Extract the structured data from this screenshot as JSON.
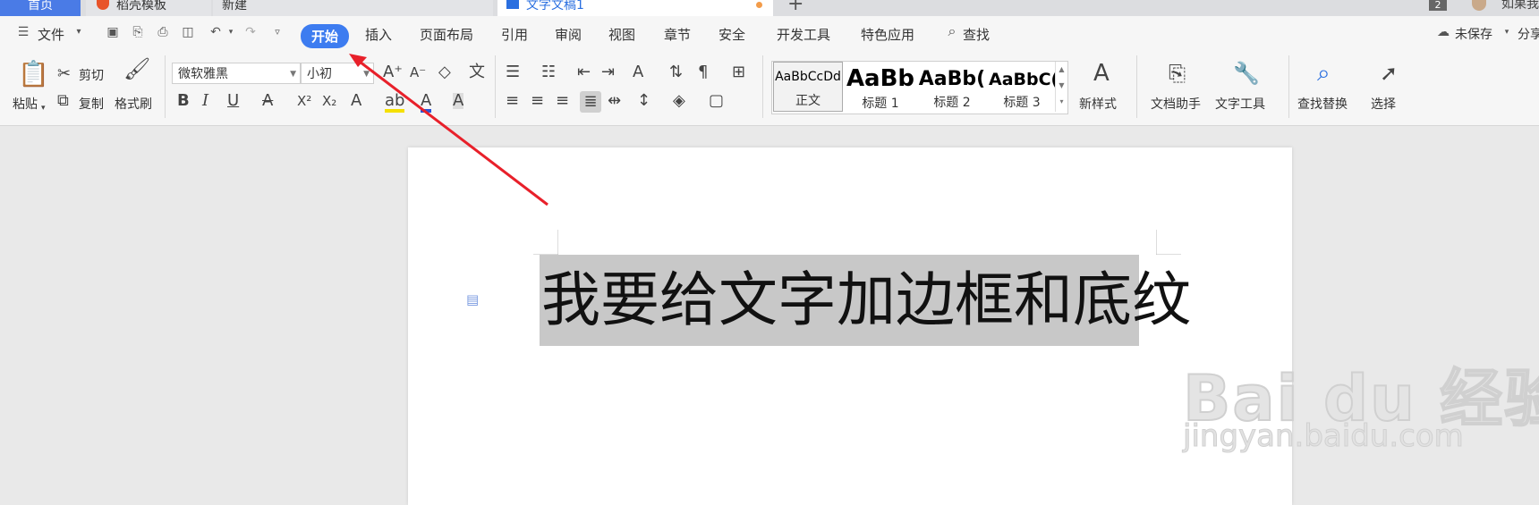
{
  "tabs": {
    "home": "首页",
    "templates": "稻壳模板",
    "new": "新建",
    "document": "文字文稿1",
    "add": "+",
    "count": "2",
    "user": "如果我"
  },
  "menu": {
    "file": "文件",
    "items": [
      "开始",
      "插入",
      "页面布局",
      "引用",
      "审阅",
      "视图",
      "章节",
      "安全",
      "开发工具",
      "特色应用"
    ],
    "search": "查找",
    "unsaved": "未保存",
    "share": "分享"
  },
  "ribbon": {
    "paste": "粘贴",
    "cut": "剪切",
    "copy": "复制",
    "format_painter": "格式刷",
    "font_name": "微软雅黑",
    "font_size": "小初",
    "styles": [
      {
        "sample": "AaBbCcDd",
        "name": "正文"
      },
      {
        "sample": "AaBb",
        "name": "标题 1"
      },
      {
        "sample": "AaBb(",
        "name": "标题 2"
      },
      {
        "sample": "AaBbC(",
        "name": "标题 3"
      }
    ],
    "new_style": "新样式",
    "doc_helper": "文档助手",
    "text_tools": "文字工具",
    "find_replace": "查找替换",
    "select": "选择"
  },
  "document": {
    "heading": "我要给文字加边框和底纹"
  },
  "watermark": {
    "logo": "Bai du 经验",
    "url": "jingyan.baidu.com"
  },
  "colors": {
    "accent": "#3d7cf0",
    "annotation_arrow": "#e8202a",
    "selection": "#c8c8c8"
  }
}
